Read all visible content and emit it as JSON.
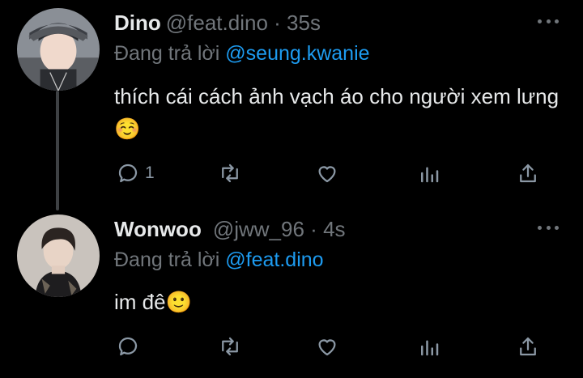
{
  "tweets": [
    {
      "author_name": "Dino",
      "handle": "@feat.dino",
      "separator": "·",
      "time": "35s",
      "replying_prefix": "Đang trả lời ",
      "replying_to": "@seung.kwanie",
      "text": "thích cái cách ảnh vạch áo cho người xem lưng☺️",
      "reply_count": "1"
    },
    {
      "author_name": "Wonwoo",
      "handle": "@jww_96",
      "separator": "·",
      "time": "4s",
      "replying_prefix": "Đang trả lời ",
      "replying_to": "@feat.dino",
      "text": "im đê🙂",
      "reply_count": ""
    }
  ],
  "icons": {
    "reply": "speech-bubble-icon",
    "retweet": "retweet-arrows-icon",
    "like": "heart-outline-icon",
    "views": "bar-chart-icon",
    "share": "share-upload-icon",
    "more": "three-dots-icon"
  },
  "colors": {
    "background": "#000000",
    "text": "#e7e9ea",
    "secondary": "#71767b",
    "mention": "#1d9bf0",
    "thread_line": "#3e4144"
  }
}
